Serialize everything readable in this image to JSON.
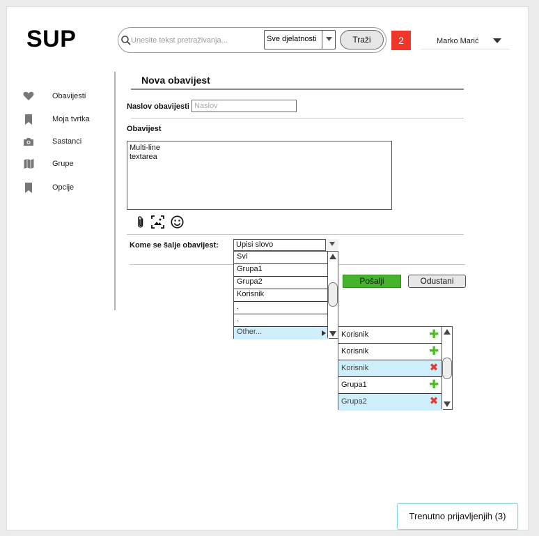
{
  "app": {
    "logo": "SUP"
  },
  "header": {
    "search": {
      "placeholder": "Unesite tekst pretraživanja...",
      "value": ""
    },
    "category_select": {
      "selected": "Sve djelatnosti"
    },
    "search_button": "Traži",
    "notification_count": "2",
    "user_name": "Marko Marić"
  },
  "sidebar": {
    "items": [
      {
        "label": "Obavijesti",
        "icon": "heart-icon"
      },
      {
        "label": "Moja tvrtka",
        "icon": "bookmark-icon"
      },
      {
        "label": "Sastanci",
        "icon": "camera-icon"
      },
      {
        "label": "Grupe",
        "icon": "map-icon"
      },
      {
        "label": "Opcije",
        "icon": "bookmark-icon"
      }
    ]
  },
  "form": {
    "title": "Nova obavijest",
    "subject_label": "Naslov obavijesti",
    "subject_placeholder": "Naslov",
    "body_label": "Obavijest",
    "body_value": "Multi-line\ntextarea",
    "toolbar_icons": [
      "paperclip-icon",
      "image-icon",
      "smiley-icon"
    ],
    "recipients_label": "Kome se šalje obavijest:",
    "recipients_combo_value": "Upisi slovo",
    "recipients_options": [
      "Svi",
      "Grupa1",
      "Grupa2",
      "Korisnik",
      ".",
      ".",
      "Other..."
    ],
    "send_button": "Pošalji",
    "cancel_button": "Odustani"
  },
  "submenu": {
    "items": [
      {
        "label": "Korisnik",
        "action": "add",
        "highlighted": false
      },
      {
        "label": "Korisnik",
        "action": "add",
        "highlighted": false
      },
      {
        "label": "Korisnik",
        "action": "remove",
        "highlighted": true
      },
      {
        "label": "Grupa1",
        "action": "add",
        "highlighted": false
      },
      {
        "label": "Grupa2",
        "action": "remove",
        "highlighted": true
      }
    ],
    "add_symbol": "✚",
    "remove_symbol": "✖"
  },
  "footer": {
    "online_button": "Trenutno prijavljenjih (3)"
  },
  "colors": {
    "notification": "#f0352a",
    "send": "#45b42c",
    "highlight": "#cdeefa",
    "add": "#4cbf27",
    "remove": "#e8392c"
  }
}
